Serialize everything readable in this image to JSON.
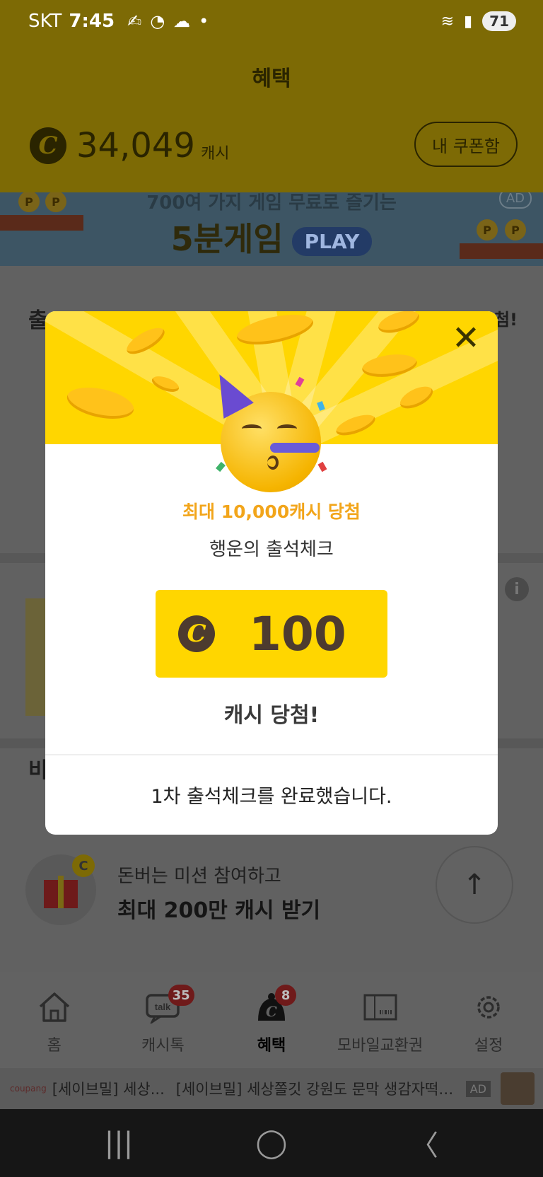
{
  "status_bar": {
    "carrier": "SKT",
    "time": "7:45",
    "battery": "71"
  },
  "header": {
    "title": "혜택",
    "cash_amount": "34,049",
    "cash_unit": "캐시",
    "coupon_button": "내 쿠폰함"
  },
  "banner": {
    "subtitle": "700여 가지 게임 무료로 즐기는",
    "title": "5분게임",
    "play_label": "PLAY",
    "ad_label": "AD"
  },
  "background": {
    "attendance_fragment": "출",
    "attendance_fragment_right": "첨!",
    "section_fragment": "비",
    "mission_line1": "돈버는 미션 참여하고",
    "mission_line2": "최대 200만 캐시 받기"
  },
  "bottom_nav": {
    "items": [
      {
        "label": "홈",
        "badge": ""
      },
      {
        "label": "캐시톡",
        "badge": "35"
      },
      {
        "label": "혜택",
        "badge": "8"
      },
      {
        "label": "모바일교환권",
        "badge": ""
      },
      {
        "label": "설정",
        "badge": ""
      }
    ],
    "active_index": 2
  },
  "ad_strip": {
    "brand": "coupang",
    "text1": "[세이브밀] 세상...",
    "text2": "[세이브밀] 세상쫄깃 강원도 문막 생감자떡 ...",
    "ad_tag": "AD"
  },
  "modal": {
    "subtitle": "최대 10,000캐시 당첨",
    "name": "행운의 출석체크",
    "prize_amount": "100",
    "coin_symbol": "C",
    "won_label": "캐시 당첨!",
    "done_message": "1차 출석체크를 완료했습니다.",
    "close_symbol": "✕"
  },
  "colors": {
    "accent_yellow": "#ffd600",
    "subtitle_orange": "#f2a51a",
    "prize_brown": "#4d3b2f"
  }
}
